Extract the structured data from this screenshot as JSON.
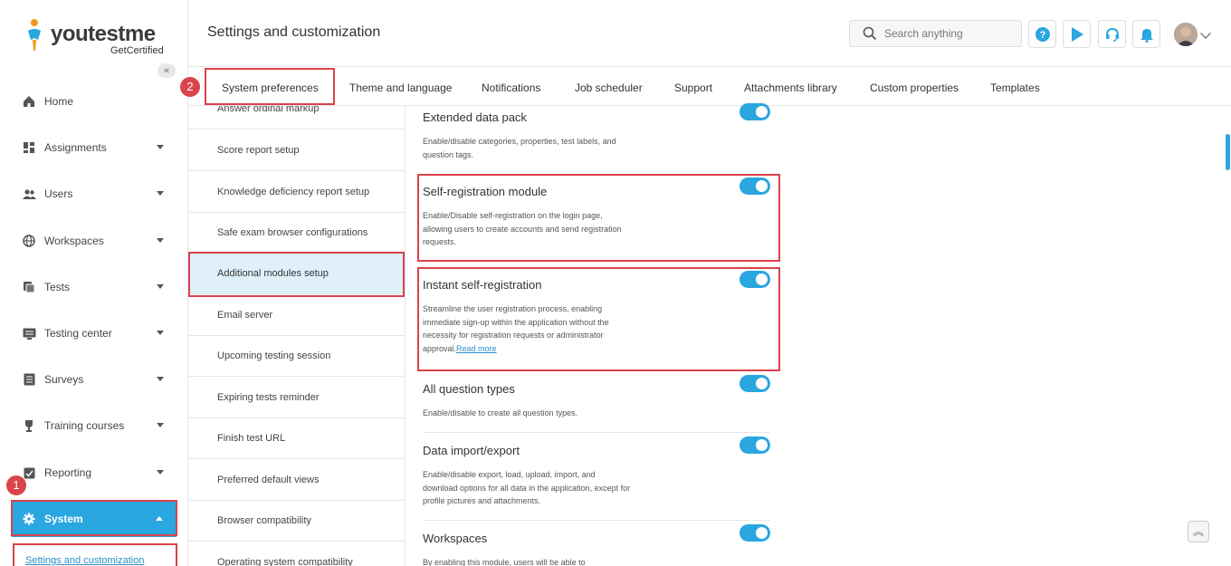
{
  "logo": {
    "name": "youtestme",
    "sub": "GetCertified"
  },
  "sidebar": {
    "collapse": "«",
    "items": [
      {
        "label": "Home",
        "icon": "home-icon"
      },
      {
        "label": "Assignments",
        "icon": "assignments-icon"
      },
      {
        "label": "Users",
        "icon": "users-icon"
      },
      {
        "label": "Workspaces",
        "icon": "globe-icon"
      },
      {
        "label": "Tests",
        "icon": "tests-icon"
      },
      {
        "label": "Testing center",
        "icon": "testing-center-icon"
      },
      {
        "label": "Surveys",
        "icon": "surveys-icon"
      },
      {
        "label": "Training courses",
        "icon": "trophy-icon"
      },
      {
        "label": "Reporting",
        "icon": "reporting-icon"
      },
      {
        "label": "System",
        "icon": "gear-icon"
      }
    ],
    "sub_link": "Settings and customization"
  },
  "header": {
    "title": "Settings and customization",
    "search_placeholder": "Search anything"
  },
  "badges": {
    "first": "1",
    "second": "2"
  },
  "tabs": [
    "System preferences",
    "Theme and language",
    "Notifications",
    "Job scheduler",
    "Support",
    "Attachments library",
    "Custom properties",
    "Templates"
  ],
  "settings_list": [
    "Answer ordinal markup",
    "Score report setup",
    "Knowledge deficiency report setup",
    "Safe exam browser configurations",
    "Additional modules setup",
    "Email server",
    "Upcoming testing session",
    "Expiring tests reminder",
    "Finish test URL",
    "Preferred default views",
    "Browser compatibility",
    "Operating system compatibility"
  ],
  "modules": [
    {
      "title": "Extended data pack",
      "desc": "Enable/disable categories, properties, test labels, and question tags.",
      "enabled": true
    },
    {
      "title": "Self-registration module",
      "desc": "Enable/Disable self-registration on the login page, allowing users to create accounts and send registration requests.",
      "enabled": true
    },
    {
      "title": "Instant self-registration",
      "desc": "Streamline the user registration process, enabling immediate sign-up within the application without the necessity for registration requests or administrator approval.",
      "link": "Read more",
      "enabled": true
    },
    {
      "title": "All question types",
      "desc": "Enable/disable to create all question types.",
      "enabled": true
    },
    {
      "title": "Data import/export",
      "desc": "Enable/disable export, load, upload, import, and download options for all data in the application, except for profile pictures and attachments.",
      "enabled": true
    },
    {
      "title": "Workspaces",
      "desc": "By enabling this module, users will be able to",
      "enabled": true
    }
  ],
  "scroll_top": "︽",
  "colors": {
    "accent": "#2aa6e0",
    "highlight": "#d9434b"
  }
}
